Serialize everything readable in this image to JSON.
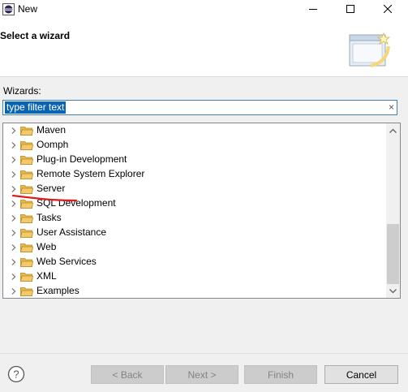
{
  "window": {
    "title": "New"
  },
  "header": {
    "title": "Select a wizard"
  },
  "wizards_label": "Wizards:",
  "filter": {
    "value": "type filter text",
    "clear_icon": "×"
  },
  "tree": {
    "items": [
      {
        "label": "Maven"
      },
      {
        "label": "Oomph"
      },
      {
        "label": "Plug-in Development"
      },
      {
        "label": "Remote System Explorer"
      },
      {
        "label": "Server"
      },
      {
        "label": "SQL Development"
      },
      {
        "label": "Tasks"
      },
      {
        "label": "User Assistance"
      },
      {
        "label": "Web"
      },
      {
        "label": "Web Services"
      },
      {
        "label": "XML"
      },
      {
        "label": "Examples"
      }
    ]
  },
  "buttons": {
    "back": "< Back",
    "next": "Next >",
    "finish": "Finish",
    "cancel": "Cancel"
  },
  "colors": {
    "selection": "#0a64b4",
    "annotation": "#d92020",
    "folder": "#f3c96b"
  }
}
